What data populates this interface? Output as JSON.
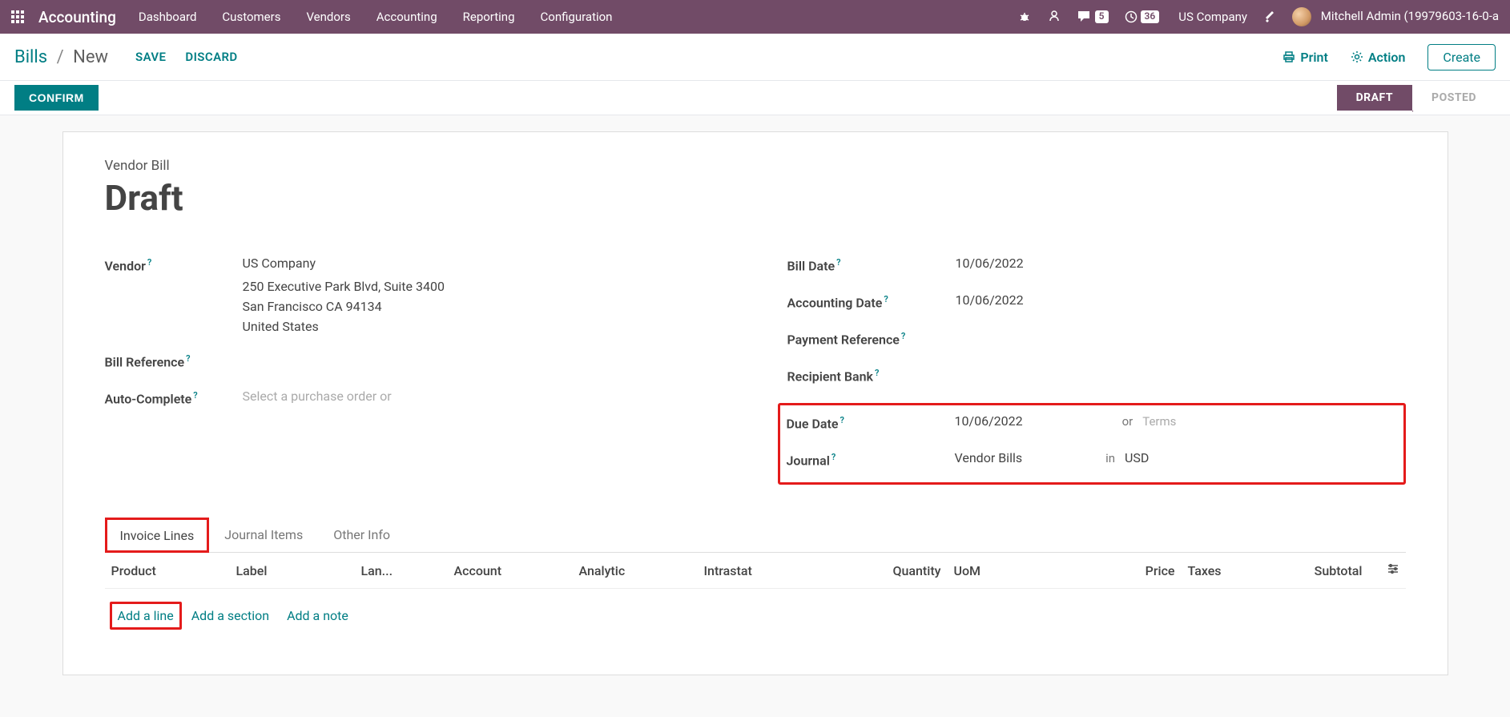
{
  "nav": {
    "app_name": "Accounting",
    "menu": [
      "Dashboard",
      "Customers",
      "Vendors",
      "Accounting",
      "Reporting",
      "Configuration"
    ],
    "messages_count": "5",
    "activities_count": "36",
    "company": "US Company",
    "user": "Mitchell Admin (19979603-16-0-a"
  },
  "cp": {
    "bc_root": "Bills",
    "bc_sep": "/",
    "bc_leaf": "New",
    "save": "SAVE",
    "discard": "DISCARD",
    "print": "Print",
    "action": "Action",
    "create": "Create"
  },
  "status": {
    "confirm": "CONFIRM",
    "draft": "DRAFT",
    "posted": "POSTED"
  },
  "form": {
    "kicker": "Vendor Bill",
    "title": "Draft",
    "labels": {
      "vendor": "Vendor",
      "bill_ref": "Bill Reference",
      "auto_complete": "Auto-Complete",
      "bill_date": "Bill Date",
      "acct_date": "Accounting Date",
      "pay_ref": "Payment Reference",
      "rec_bank": "Recipient Bank",
      "due_date": "Due Date",
      "journal": "Journal"
    },
    "vendor_name": "US Company",
    "vendor_addr1": "250 Executive Park Blvd, Suite 3400",
    "vendor_addr2": "San Francisco CA 94134",
    "vendor_addr3": "United States",
    "auto_complete_placeholder": "Select a purchase order or",
    "bill_date": "10/06/2022",
    "acct_date": "10/06/2022",
    "due_date": "10/06/2022",
    "or_text": "or",
    "terms_placeholder": "Terms",
    "journal": "Vendor Bills",
    "in_text": "in",
    "currency": "USD"
  },
  "tabs": {
    "invoice_lines": "Invoice Lines",
    "journal_items": "Journal Items",
    "other_info": "Other Info"
  },
  "table": {
    "cols": {
      "product": "Product",
      "label": "Label",
      "lan": "Lan...",
      "account": "Account",
      "analytic": "Analytic",
      "intrastat": "Intrastat",
      "quantity": "Quantity",
      "uom": "UoM",
      "price": "Price",
      "taxes": "Taxes",
      "subtotal": "Subtotal"
    },
    "add_line": "Add a line",
    "add_section": "Add a section",
    "add_note": "Add a note"
  }
}
